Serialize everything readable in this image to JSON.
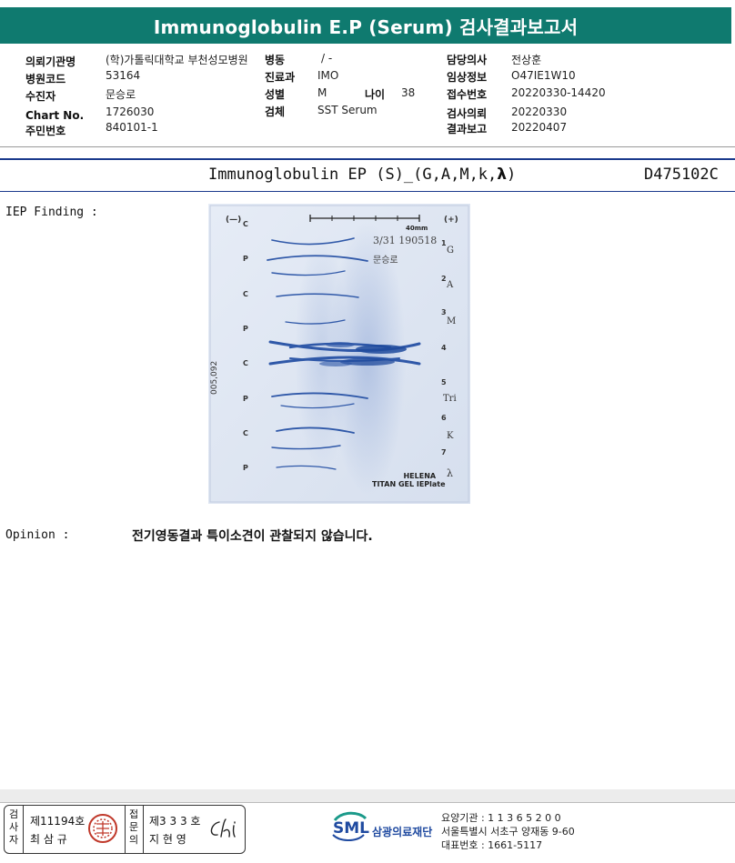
{
  "report": {
    "title": "Immunoglobulin E.P (Serum) 검사결과보고서"
  },
  "info": {
    "col1": [
      {
        "label": "의뢰기관명",
        "value": "(학)가톨릭대학교 부천성모병원"
      },
      {
        "label": "병원코드",
        "value": "53164"
      },
      {
        "label": "수진자",
        "value": "문승로"
      },
      {
        "label": "Chart No.",
        "value": "1726030"
      },
      {
        "label": "주민번호",
        "value": "840101-1"
      }
    ],
    "col2": [
      {
        "label": "병동",
        "value": "/ -"
      },
      {
        "label": "진료과",
        "value": "IMO"
      },
      {
        "label": "성별",
        "value": "M"
      },
      {
        "label": "검체",
        "value": "SST Serum"
      }
    ],
    "age": {
      "label": "나이",
      "value": "38"
    },
    "col3": [
      {
        "label": "담당의사",
        "value": "전상훈"
      },
      {
        "label": "임상정보",
        "value": "O47IE1W10"
      },
      {
        "label": "접수번호",
        "value": "20220330-14420"
      },
      {
        "label": "검사의뢰",
        "value": "20220330"
      },
      {
        "label": "결과보고",
        "value": "20220407"
      }
    ]
  },
  "test": {
    "name": "Immunoglobulin EP (S)_(G,A,M,k,",
    "lambda": "λ",
    "close": ")",
    "code": "D475102C"
  },
  "finding": {
    "label": "IEP Finding :"
  },
  "gel": {
    "minus": "(—)",
    "plus": "(+)",
    "scale": "40mm",
    "date_code": "3/31 190518",
    "patient": "문승로",
    "side_code": "005,092",
    "brand1": "HELENA",
    "brand2": "TITAN GEL IEPlate",
    "rows": [
      "C",
      "P",
      "C",
      "P",
      "C",
      "P",
      "C",
      "P"
    ],
    "lane_numbers": [
      "1",
      "2",
      "3",
      "4",
      "5",
      "6",
      "7"
    ],
    "lane_labels": [
      "G",
      "A",
      "M",
      "Tri",
      "K",
      "λ"
    ]
  },
  "opinion": {
    "label": "Opinion :",
    "text": "전기영동결과 특이소견이 관찰되지 않습니다."
  },
  "footer": {
    "signer1_role_chars": [
      "검",
      "사",
      "자"
    ],
    "signer1_num": "제11194호",
    "signer1_name": "최 삼 규",
    "signer2_role_chars": [
      "접",
      "문",
      "의"
    ],
    "signer2_num": "제3 3 3 호",
    "signer2_name": "지 현 영",
    "logo_text": "SML",
    "org_name": "삼광의료재단",
    "agency": "요양기관 : 1 1 3 6 5 2 0 0",
    "address": "서울특별시 서초구 양재동 9-60",
    "phone": "대표번호 : 1661-5117"
  },
  "colors": {
    "title_bar": "#0f7a6f",
    "rule_blue": "#1a3a8c",
    "gel_bg": "#dfe6f2",
    "band_blue": "#2f58a8"
  }
}
